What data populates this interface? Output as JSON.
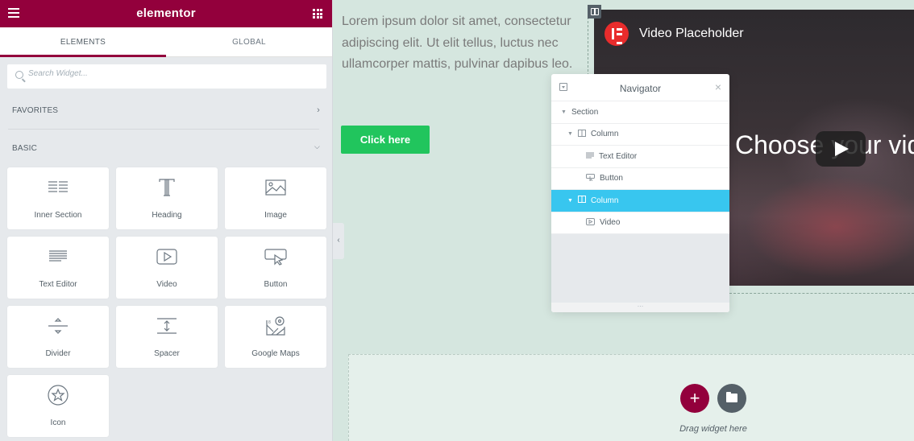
{
  "panel": {
    "brand": "elementor",
    "tabs": [
      {
        "label": "ELEMENTS",
        "active": true
      },
      {
        "label": "GLOBAL",
        "active": false
      }
    ],
    "search": {
      "placeholder": "Search Widget..."
    },
    "categories": {
      "favorites": "FAVORITES",
      "basic": "BASIC"
    },
    "widgets": [
      {
        "label": "Inner Section",
        "icon": "inner-section-icon"
      },
      {
        "label": "Heading",
        "icon": "heading-icon"
      },
      {
        "label": "Image",
        "icon": "image-icon"
      },
      {
        "label": "Text Editor",
        "icon": "text-editor-icon"
      },
      {
        "label": "Video",
        "icon": "video-icon"
      },
      {
        "label": "Button",
        "icon": "button-icon"
      },
      {
        "label": "Divider",
        "icon": "divider-icon"
      },
      {
        "label": "Spacer",
        "icon": "spacer-icon"
      },
      {
        "label": "Google Maps",
        "icon": "google-maps-icon"
      },
      {
        "label": "Icon",
        "icon": "star-icon"
      }
    ]
  },
  "canvas": {
    "text": "Lorem ipsum dolor sit amet, consectetur adipiscing elit. Ut elit tellus, luctus nec ullamcorper mattis, pulvinar dapibus leo.",
    "button_label": "Click here",
    "video": {
      "title": "Video Placeholder",
      "overlay_text": "Choose your vid"
    },
    "drop_hint": "Drag widget here"
  },
  "navigator": {
    "title": "Navigator",
    "items": [
      {
        "label": "Section",
        "depth": 0,
        "selected": false
      },
      {
        "label": "Column",
        "depth": 1,
        "selected": false
      },
      {
        "label": "Text Editor",
        "depth": 2,
        "selected": false
      },
      {
        "label": "Button",
        "depth": 2,
        "selected": false
      },
      {
        "label": "Column",
        "depth": 1,
        "selected": true
      },
      {
        "label": "Video",
        "depth": 2,
        "selected": false
      }
    ]
  },
  "colors": {
    "brand": "#93003c",
    "accent_selected": "#38c6ef",
    "button_green": "#21c55d",
    "canvas_bg": "#d5e6df"
  }
}
